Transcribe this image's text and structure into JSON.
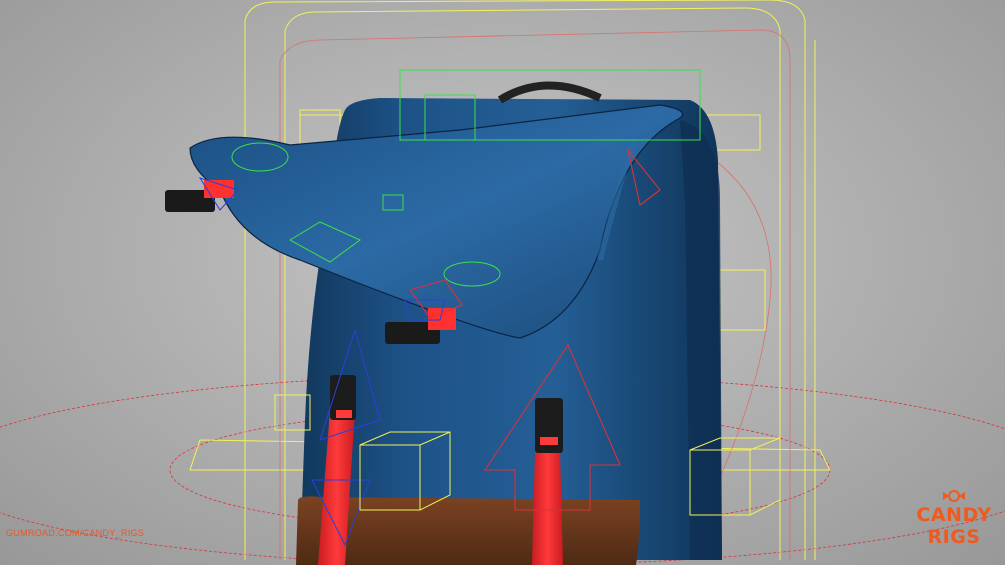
{
  "viewport": {
    "background": "#b4b4b4",
    "bag_color": "#1b4e7c",
    "strap_color": "#e8242a",
    "leather_color": "#6e3a1e"
  },
  "overlay": {
    "watermark": "GUMROAD.COM/CANDY_RIGS",
    "logo_line1": "CANDY",
    "logo_line2": "RIGS",
    "logo_color": "#ef5a1e",
    "logo_icon": "candy-icon"
  },
  "rig_colors": {
    "controls_yellow": "#f2f25a",
    "controls_green": "#3ae04a",
    "controls_red": "#d8323a",
    "controls_blue": "#2a40d8"
  }
}
